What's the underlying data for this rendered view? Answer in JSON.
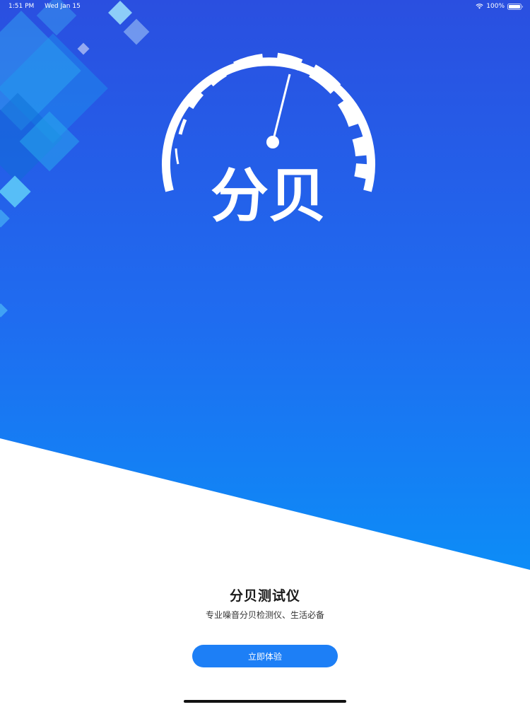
{
  "status_bar": {
    "time": "1:51 PM",
    "date": "Wed Jan 15",
    "battery_text": "100%",
    "icons": [
      "wifi-icon",
      "battery-icon"
    ]
  },
  "logo": {
    "text": "分贝",
    "icon": "speedometer-gauge-icon"
  },
  "app": {
    "title": "分贝测试仪",
    "subtitle": "专业噪音分贝检测仪、生活必备"
  },
  "actions": {
    "start_label": "立即体验"
  },
  "colors": {
    "gradient_top": "#2a4fe0",
    "gradient_bottom": "#0a93f9",
    "button": "#1d7ff6",
    "title_text": "#1a1a1a"
  }
}
